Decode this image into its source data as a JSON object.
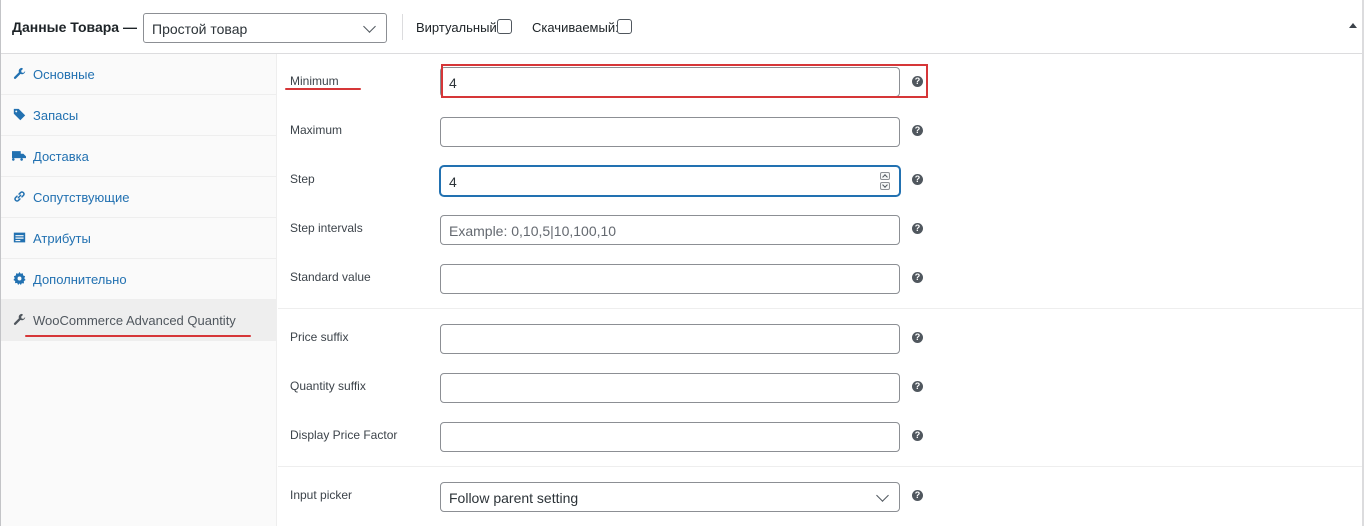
{
  "header": {
    "title": "Данные Товара —",
    "product_type": "Простой товар",
    "virtual_label": "Виртуальный:",
    "downloadable_label": "Скачиваемый:",
    "virtual_checked": false,
    "downloadable_checked": false
  },
  "sidebar": {
    "items": [
      {
        "label": "Основные",
        "icon": "wrench-icon"
      },
      {
        "label": "Запасы",
        "icon": "tag-icon"
      },
      {
        "label": "Доставка",
        "icon": "truck-icon"
      },
      {
        "label": "Сопутствующие",
        "icon": "link-icon"
      },
      {
        "label": "Атрибуты",
        "icon": "list-icon"
      },
      {
        "label": "Дополнительно",
        "icon": "gear-icon"
      },
      {
        "label": "WooCommerce Advanced Quantity",
        "icon": "wrench-icon",
        "active": true
      }
    ]
  },
  "fields": {
    "minimum": {
      "label": "Minimum",
      "value": "4"
    },
    "maximum": {
      "label": "Maximum",
      "value": ""
    },
    "step": {
      "label": "Step",
      "value": "4"
    },
    "step_intervals": {
      "label": "Step intervals",
      "placeholder": "Example: 0,10,5|10,100,10"
    },
    "standard_value": {
      "label": "Standard value",
      "value": ""
    },
    "price_suffix": {
      "label": "Price suffix",
      "value": ""
    },
    "quantity_suffix": {
      "label": "Quantity suffix",
      "value": ""
    },
    "display_price_factor": {
      "label": "Display Price Factor",
      "value": ""
    },
    "input_picker": {
      "label": "Input picker",
      "value": "Follow parent setting"
    }
  },
  "help_glyph": "?",
  "annotation_color": "#d63638"
}
